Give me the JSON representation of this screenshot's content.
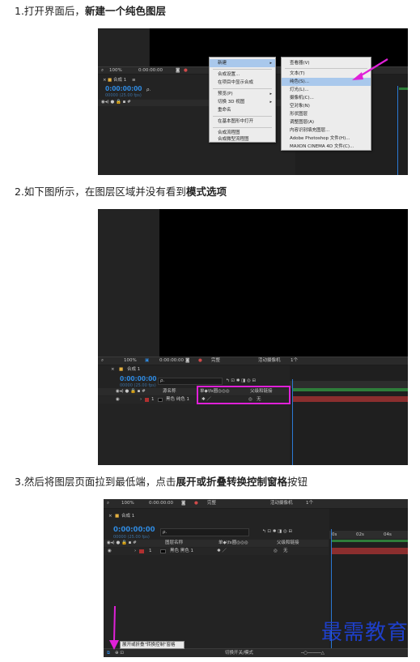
{
  "steps": [
    {
      "prefix": "1.打开界面后，",
      "bold": "新建一个纯色图层",
      "suffix": ""
    },
    {
      "prefix": "2.如下图所示，在图层区域并没有看到",
      "bold": "模式选项",
      "suffix": ""
    },
    {
      "prefix": "3.然后将图层页面拉到最低端，点击",
      "bold": "展开或折叠转换控制窗格",
      "suffix": "按钮"
    }
  ],
  "shot1": {
    "zoom": "100%",
    "timecode_small": "0:00:00:00",
    "comp_tab": "合成 1",
    "timecode": "0:00:00:00",
    "timecode_sub": "00000 (25.00 fps)",
    "context_menu": {
      "items": [
        {
          "label": "新建",
          "highlighted": true,
          "submenu": true
        },
        {
          "label": "合成设置...",
          "highlighted": false,
          "submenu": false
        },
        {
          "label": "在项目中显示合成",
          "highlighted": false,
          "submenu": false
        },
        {
          "label": "预览(P)",
          "highlighted": false,
          "submenu": true
        },
        {
          "label": "切换 3D 视图",
          "highlighted": false,
          "submenu": true
        },
        {
          "label": "重命名",
          "highlighted": false,
          "submenu": false
        },
        {
          "label": "在基本图形中打开",
          "highlighted": false,
          "submenu": false
        },
        {
          "label": "合成流程图",
          "highlighted": false,
          "submenu": false
        },
        {
          "label": "合成微型流程图",
          "highlighted": false,
          "submenu": false
        }
      ]
    },
    "submenu": {
      "items": [
        {
          "label": "查看器(V)",
          "highlighted": false
        },
        {
          "label": "文本(T)",
          "highlighted": false
        },
        {
          "label": "纯色(S)...",
          "highlighted": true
        },
        {
          "label": "灯光(L)...",
          "highlighted": false
        },
        {
          "label": "摄像机(C)...",
          "highlighted": false
        },
        {
          "label": "空对象(N)",
          "highlighted": false
        },
        {
          "label": "形状图层",
          "highlighted": false
        },
        {
          "label": "调整图层(A)",
          "highlighted": false
        },
        {
          "label": "内容识别填充图层...",
          "highlighted": false
        },
        {
          "label": "Adobe Photoshop 文件(H)...",
          "highlighted": false
        },
        {
          "label": "MAXON CINEMA 4D 文件(C)...",
          "highlighted": false
        }
      ]
    }
  },
  "shot2": {
    "zoom": "100%",
    "timecode_small": "0:00:00:00",
    "view_quality": "完整",
    "camera": "活动摄像机",
    "views": "1个",
    "comp_tab": "合成 1",
    "timecode": "0:00:00:00",
    "timecode_sub": "00000 (25.00 fps)",
    "search_placeholder": "ρ.",
    "col_source_name": "源名称",
    "col_switches": "单◆\\fx圈◎◎◎",
    "col_parent": "父级和链接",
    "layer_index": "1",
    "layer_name": "黑色 纯色 1",
    "parent_value": "无"
  },
  "shot3": {
    "zoom": "100%",
    "timecode_small": "0:00:00:00",
    "view_quality": "完整",
    "camera": "活动摄像机",
    "views": "1个",
    "comp_tab": "合成 1",
    "timecode": "0:00:00:00",
    "timecode_sub": "00000 (25.00 fps)",
    "search_placeholder": "ρ.",
    "col_layer_name": "图层名称",
    "col_switches": "单◆\\fx圈◎◎◎",
    "col_parent": "父级和链接",
    "ruler_marks": [
      "0s",
      "02s",
      "04s"
    ],
    "layer_index": "1",
    "layer_name": "黑色 黑色 1",
    "parent_value": "无",
    "tooltip": "展开或折叠\"转换控制\"窗格",
    "bottom_toggle": "切换开关/模式"
  },
  "watermark": "最需教育",
  "colors": {
    "highlight_magenta": "#e020d8",
    "timecode_blue": "#2f8ae0",
    "menu_highlight": "#a9c8ec",
    "watermark_blue": "#1e3fc9"
  }
}
